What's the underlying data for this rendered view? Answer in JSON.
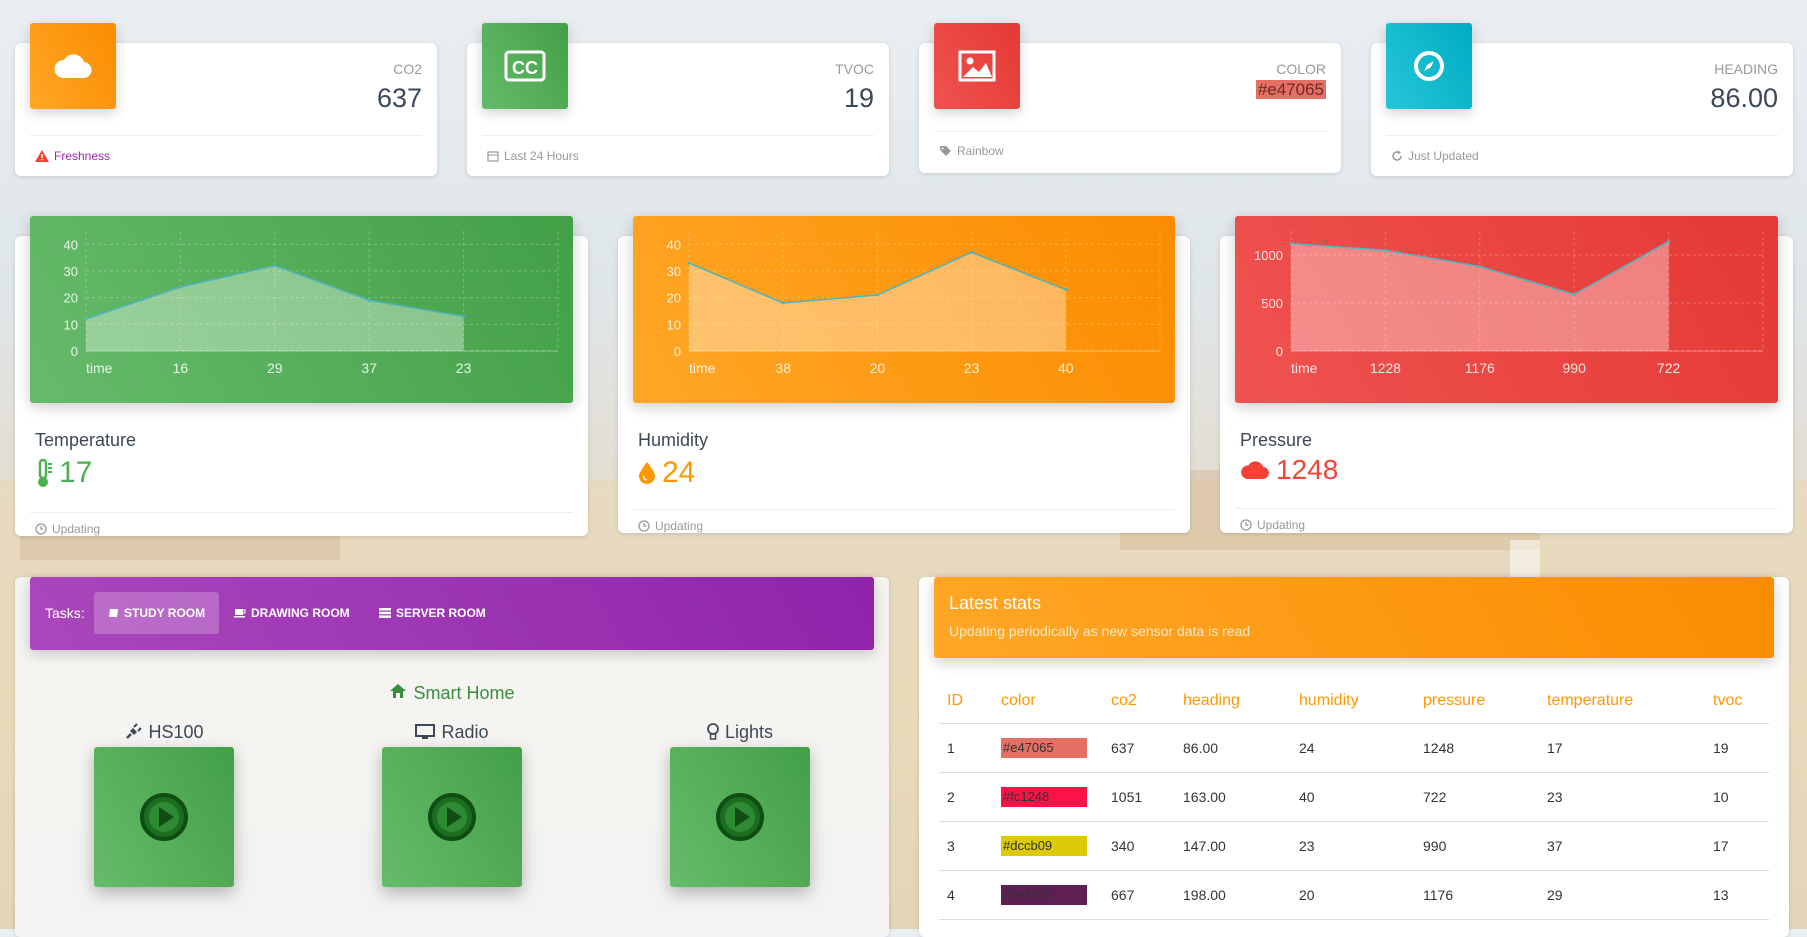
{
  "colors": {
    "orange": "#ff9800",
    "green": "#4caf50",
    "red": "#f44336",
    "cyan": "#00bcd4",
    "purple": "#9c27b0"
  },
  "stat_cards": [
    {
      "icon": "cloud-icon",
      "category": "CO2",
      "value": "637",
      "footer": "Freshness",
      "footer_icon": "warning-icon"
    },
    {
      "icon": "cc-icon",
      "category": "TVOC",
      "value": "19",
      "footer": "Last 24 Hours",
      "footer_icon": "calendar-icon"
    },
    {
      "icon": "image-icon",
      "category": "COLOR",
      "value": "#e47065",
      "footer": "Rainbow",
      "footer_icon": "tag-icon"
    },
    {
      "icon": "compass-icon",
      "category": "HEADING",
      "value": "86.00",
      "footer": "Just Updated",
      "footer_icon": "refresh-icon"
    }
  ],
  "chart_cards": [
    {
      "title": "Temperature",
      "value": "17",
      "icon": "thermometer-icon",
      "footer": "Updating",
      "footer_icon": "clock-icon"
    },
    {
      "title": "Humidity",
      "value": "24",
      "icon": "droplet-icon",
      "footer": "Updating",
      "footer_icon": "clock-icon"
    },
    {
      "title": "Pressure",
      "value": "1248",
      "icon": "cloud-icon",
      "footer": "Updating",
      "footer_icon": "clock-icon"
    }
  ],
  "chart_data": [
    {
      "type": "area",
      "x": [
        "time",
        "16",
        "29",
        "37",
        "23"
      ],
      "values": [
        12,
        24,
        32,
        19,
        13
      ],
      "yticks": [
        "0",
        "10",
        "20",
        "30",
        "40"
      ],
      "ylim": [
        0,
        45
      ]
    },
    {
      "type": "area",
      "x": [
        "time",
        "38",
        "20",
        "23",
        "40"
      ],
      "values": [
        33,
        18,
        21,
        37,
        23
      ],
      "yticks": [
        "0",
        "10",
        "20",
        "30",
        "40"
      ],
      "ylim": [
        0,
        45
      ]
    },
    {
      "type": "area",
      "x": [
        "time",
        "1228",
        "1176",
        "990",
        "722"
      ],
      "values": [
        1120,
        1050,
        880,
        590,
        1140
      ],
      "yticks": [
        "0",
        "500",
        "1000"
      ],
      "ylim": [
        0,
        1250
      ]
    }
  ],
  "tasks": {
    "label": "Tasks:",
    "tabs": [
      {
        "label": "STUDY ROOM",
        "icon": "book-icon"
      },
      {
        "label": "DRAWING ROOM",
        "icon": "cup-icon"
      },
      {
        "label": "SERVER ROOM",
        "icon": "server-icon"
      }
    ]
  },
  "smart_home": {
    "title": "Smart Home",
    "devices": [
      {
        "label": "HS100",
        "icon": "plug-icon"
      },
      {
        "label": "Radio",
        "icon": "monitor-icon"
      },
      {
        "label": "Lights",
        "icon": "bulb-icon"
      }
    ]
  },
  "latest_stats": {
    "title": "Latest stats",
    "subtitle": "Updating periodically as new sensor data is read",
    "columns": [
      "ID",
      "color",
      "co2",
      "heading",
      "humidity",
      "pressure",
      "temperature",
      "tvoc"
    ],
    "rows": [
      [
        "1",
        "#e47065",
        "637",
        "86.00",
        "24",
        "1248",
        "17",
        "19"
      ],
      [
        "2",
        "#fc1248",
        "1051",
        "163.00",
        "40",
        "722",
        "23",
        "10"
      ],
      [
        "3",
        "#dccb09",
        "340",
        "147.00",
        "23",
        "990",
        "37",
        "17"
      ],
      [
        "4",
        "#5e1f55",
        "667",
        "198.00",
        "20",
        "1176",
        "29",
        "13"
      ]
    ]
  }
}
